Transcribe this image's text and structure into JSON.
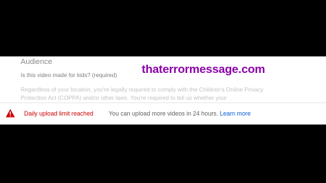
{
  "audience": {
    "title": "Audience",
    "question": "Is this video made for kids? (required)",
    "description": "Regardless of your location, you're legally required to comply with the Children's Online Privacy Protection Act (COPPA) and/or other laws. You're required to tell us whether your"
  },
  "watermark": {
    "text": "thaterrormessage.com",
    "color": "#8b00a8"
  },
  "error": {
    "icon": "warning-icon",
    "title": "Daily upload limit reached",
    "message": "You can upload more videos in 24 hours.",
    "link_label": "Learn more",
    "title_color": "#cc0000",
    "link_color": "#065fd4"
  }
}
